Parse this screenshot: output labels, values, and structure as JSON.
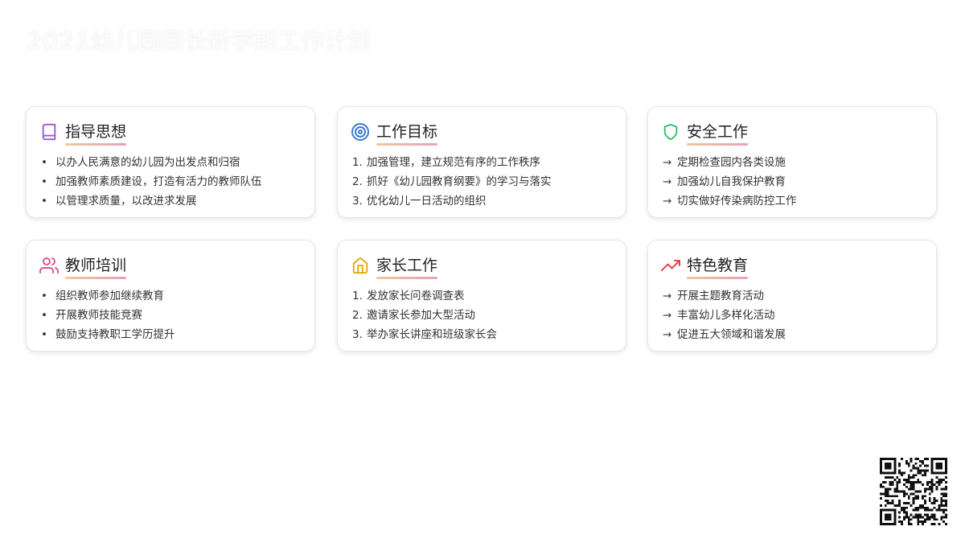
{
  "page_title": "2021幼儿园园长新学期工作计划",
  "cards": [
    {
      "title": "指导思想",
      "icon": "book-icon",
      "icon_color": "#9b59d0",
      "list_style": "bullet",
      "markers": [
        "•",
        "•",
        "•"
      ],
      "items": [
        "以办人民满意的幼儿园为出发点和归宿",
        "加强教师素质建设，打造有活力的教师队伍",
        "以管理求质量，以改进求发展"
      ]
    },
    {
      "title": "工作目标",
      "icon": "target-icon",
      "icon_color": "#3a7bd5",
      "list_style": "numbered",
      "markers": [
        "1.",
        "2.",
        "3."
      ],
      "items": [
        "加强管理，建立规范有序的工作秩序",
        "抓好《幼儿园教育纲要》的学习与落实",
        "优化幼儿一日活动的组织"
      ]
    },
    {
      "title": "安全工作",
      "icon": "shield-icon",
      "icon_color": "#2ebd6b",
      "list_style": "arrow",
      "markers": [
        "→",
        "→",
        "→"
      ],
      "items": [
        "定期检查园内各类设施",
        "加强幼儿自我保护教育",
        "切实做好传染病防控工作"
      ]
    },
    {
      "title": "教师培训",
      "icon": "users-icon",
      "icon_color": "#d9588f",
      "list_style": "bullet",
      "markers": [
        "•",
        "•",
        "•"
      ],
      "items": [
        "组织教师参加继续教育",
        "开展教师技能竞赛",
        "鼓励支持教职工学历提升"
      ]
    },
    {
      "title": "家长工作",
      "icon": "home-icon",
      "icon_color": "#e0a800",
      "list_style": "numbered",
      "markers": [
        "1.",
        "2.",
        "3."
      ],
      "items": [
        "发放家长问卷调查表",
        "邀请家长参加大型活动",
        "举办家长讲座和班级家长会"
      ]
    },
    {
      "title": "特色教育",
      "icon": "trending-up-icon",
      "icon_color": "#e04848",
      "list_style": "arrow",
      "markers": [
        "→",
        "→",
        "→"
      ],
      "items": [
        "开展主题教育活动",
        "丰富幼儿多样化活动",
        "促进五大领域和谐发展"
      ]
    }
  ],
  "qr_code": {
    "icon": "qr-code-icon"
  }
}
